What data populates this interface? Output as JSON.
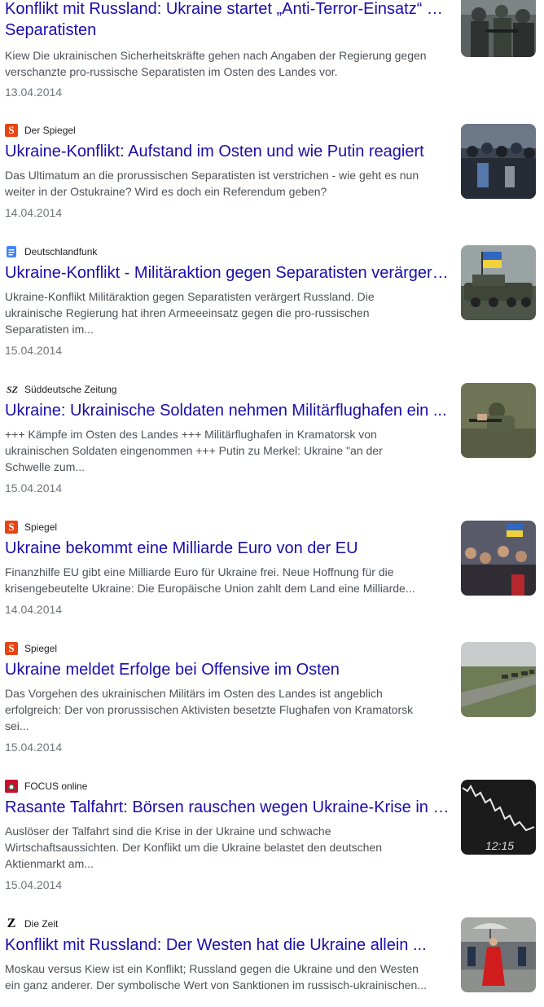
{
  "articles": [
    {
      "source": "",
      "source_icon": "none",
      "title": "Konflikt mit Russland: Ukraine startet „Anti-Terror-Einsatz“ gegen Separatisten",
      "title_line1": "Konflikt mit Russland: Ukraine startet „Anti-Terror-Einsatz“ …",
      "title_line2": "Separatisten",
      "snippet": "Kiew Die ukrainischen Sicherheitskräfte gehen nach Angaben der Regierung gegen verschanzte pro-russische Separatisten im Osten des Landes vor.",
      "date": "13.04.2014",
      "thumbnail": "armed-men-photo"
    },
    {
      "source": "Der Spiegel",
      "source_icon": "spiegel-logo-icon",
      "title": "Ukraine-Konflikt: Aufstand im Osten und wie Putin reagiert",
      "snippet": "Das Ultimatum an die prorussischen Separatisten ist verstrichen - wie geht es nun weiter in der Ostukraine? Wird es doch ein Referendum geben?",
      "date": "14.04.2014",
      "thumbnail": "crowd-riot-police-photo"
    },
    {
      "source": "Deutschlandfunk",
      "source_icon": "deutschlandfunk-logo-icon",
      "title": "Ukraine-Konflikt - Militäraktion gegen Separatisten verärgert Russland",
      "snippet": "Ukraine-Konflikt Militäraktion gegen Separatisten verärgert Russland. Die ukrainische Regierung hat ihren Armeeeinsatz gegen die pro-russischen Separatisten im...",
      "date": "15.04.2014",
      "thumbnail": "armored-vehicle-flag-photo"
    },
    {
      "source": "Süddeutsche Zeitung",
      "source_icon": "sz-logo-icon",
      "title": "Ukraine: Ukrainische Soldaten nehmen Militärflughafen ein ...",
      "snippet": "+++ Kämpfe im Osten des Landes +++ Militärflughafen in Kramatorsk von ukrainischen Soldaten eingenommen +++ Putin zu Merkel: Ukraine \"an der Schwelle zum...",
      "date": "15.04.2014",
      "thumbnail": "soldier-aiming-photo"
    },
    {
      "source": "Spiegel",
      "source_icon": "spiegel-logo-icon",
      "title": "Ukraine bekommt eine Milliarde Euro von der EU",
      "snippet": "Finanzhilfe EU gibt eine Milliarde Euro für Ukraine frei. Neue Hoffnung für die krisengebeutelte Ukraine: Die Europäische Union zahlt dem Land eine Milliarde...",
      "date": "14.04.2014",
      "thumbnail": "crowd-flags-photo"
    },
    {
      "source": "Spiegel",
      "source_icon": "spiegel-logo-icon",
      "title": "Ukraine meldet Erfolge bei Offensive im Osten",
      "snippet": "Das Vorgehen des ukrainischen Militärs im Osten des Landes ist angeblich erfolgreich: Der von prorussischen Aktivisten besetzte Flughafen von Kramatorsk sei...",
      "date": "15.04.2014",
      "thumbnail": "military-convoy-photo"
    },
    {
      "source": "FOCUS online",
      "source_icon": "focus-logo-icon",
      "title": "Rasante Talfahrt: Börsen rauschen wegen Ukraine-Krise in den Keller",
      "snippet": "Auslöser der Talfahrt sind die Krise in der Ukraine und schwache Wirtschaftsaussichten. Der Konflikt um die Ukraine belastet den deutschen Aktienmarkt am...",
      "date": "15.04.2014",
      "thumbnail": "stock-chart-photo",
      "thumbnail_text": "12:15"
    },
    {
      "source": "Die Zeit",
      "source_icon": "zeit-logo-icon",
      "title": "Konflikt mit Russland: Der Westen hat die Ukraine allein ...",
      "snippet": "Moskau versus Kiew ist ein Konflikt; Russland gegen die Ukraine und den Westen ein ganz anderer. Der symbolische Wert von Sanktionen im russisch-ukrainischen...",
      "date": "",
      "thumbnail": "woman-red-coat-umbrella-photo"
    }
  ]
}
